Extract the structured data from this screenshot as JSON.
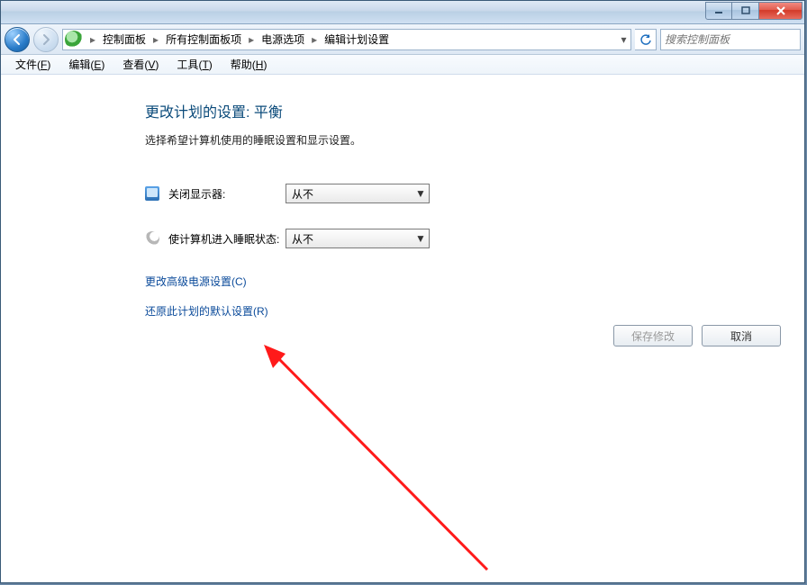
{
  "titlebar": {
    "title": ""
  },
  "nav": {
    "breadcrumbs": [
      "控制面板",
      "所有控制面板项",
      "电源选项",
      "编辑计划设置"
    ],
    "search_placeholder": "搜索控制面板"
  },
  "menubar": {
    "items": [
      {
        "label": "文件",
        "accel": "F"
      },
      {
        "label": "编辑",
        "accel": "E"
      },
      {
        "label": "查看",
        "accel": "V"
      },
      {
        "label": "工具",
        "accel": "T"
      },
      {
        "label": "帮助",
        "accel": "H"
      }
    ]
  },
  "page": {
    "title": "更改计划的设置: 平衡",
    "subtitle": "选择希望计算机使用的睡眠设置和显示设置。",
    "settings": {
      "display_off_label": "关闭显示器:",
      "display_off_value": "从不",
      "sleep_label": "使计算机进入睡眠状态:",
      "sleep_value": "从不"
    },
    "links": {
      "advanced": "更改高级电源设置(C)",
      "restore": "还原此计划的默认设置(R)"
    },
    "buttons": {
      "save": "保存修改",
      "cancel": "取消"
    }
  }
}
